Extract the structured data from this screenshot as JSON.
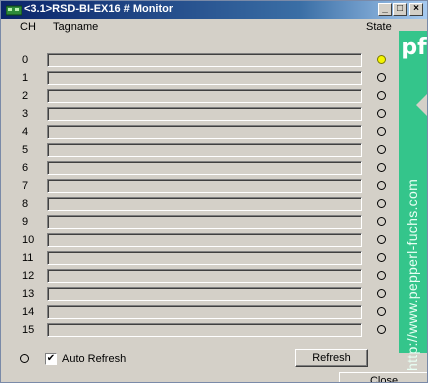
{
  "window": {
    "title": "<3.1>RSD-BI-EX16 # Monitor"
  },
  "controls": {
    "minimize": "_",
    "maximize": "□",
    "close": "×"
  },
  "columns": {
    "ch": "CH",
    "tagname": "Tagname",
    "state": "State"
  },
  "channels": [
    {
      "ch": "0",
      "tag": "",
      "state": "on"
    },
    {
      "ch": "1",
      "tag": "",
      "state": "off"
    },
    {
      "ch": "2",
      "tag": "",
      "state": "off"
    },
    {
      "ch": "3",
      "tag": "",
      "state": "off"
    },
    {
      "ch": "4",
      "tag": "",
      "state": "off"
    },
    {
      "ch": "5",
      "tag": "",
      "state": "off"
    },
    {
      "ch": "6",
      "tag": "",
      "state": "off"
    },
    {
      "ch": "7",
      "tag": "",
      "state": "off"
    },
    {
      "ch": "8",
      "tag": "",
      "state": "off"
    },
    {
      "ch": "9",
      "tag": "",
      "state": "off"
    },
    {
      "ch": "10",
      "tag": "",
      "state": "off"
    },
    {
      "ch": "11",
      "tag": "",
      "state": "off"
    },
    {
      "ch": "12",
      "tag": "",
      "state": "off"
    },
    {
      "ch": "13",
      "tag": "",
      "state": "off"
    },
    {
      "ch": "14",
      "tag": "",
      "state": "off"
    },
    {
      "ch": "15",
      "tag": "",
      "state": "off"
    }
  ],
  "brand": {
    "logo": "pf",
    "url": "http://www.pepperl-fuchs.com",
    "color": "#34c58b"
  },
  "footer": {
    "auto_refresh_label": "Auto Refresh",
    "auto_refresh_checked": true,
    "refresh_label": "Refresh",
    "close_label": "Close"
  },
  "colors": {
    "led_on": "#f4f400",
    "title_start": "#0a246a",
    "title_end": "#a6caf0"
  }
}
